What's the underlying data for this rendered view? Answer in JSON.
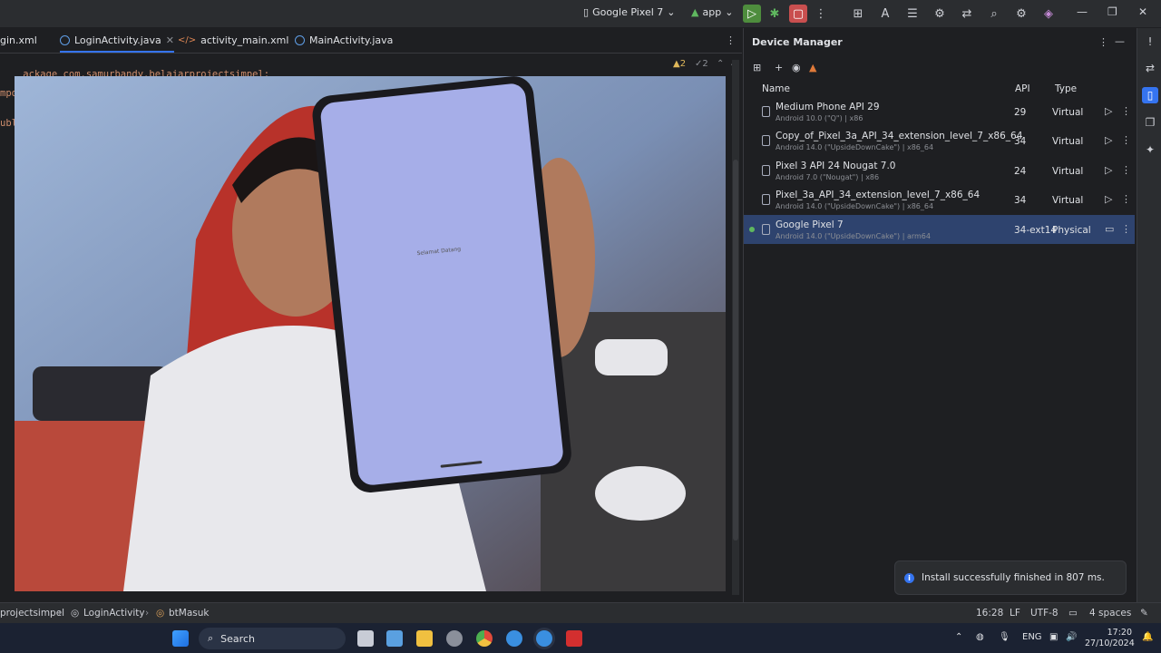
{
  "titlebar": {
    "device_selector": "Google Pixel 7",
    "run_config": "app"
  },
  "editor": {
    "tabs": [
      {
        "label": "gin.xml"
      },
      {
        "label": "LoginActivity.java"
      },
      {
        "label": "activity_main.xml"
      },
      {
        "label": "MainActivity.java"
      }
    ],
    "code_line_1": "ackage com.samurbandy.belajarprojectsimpel;",
    "code_frag_1": "mpo",
    "code_frag_2": "ubl",
    "warnings": "▲2",
    "checks": "✓2",
    "video_phone_text": "Selamat Datang"
  },
  "device_manager": {
    "title": "Device Manager",
    "columns": {
      "name": "Name",
      "api": "API",
      "type": "Type"
    },
    "devices": [
      {
        "name": "Medium Phone API 29",
        "sub": "Android 10.0 (\"Q\") | x86",
        "api": "29",
        "type": "Virtual"
      },
      {
        "name": "Copy_of_Pixel_3a_API_34_extension_level_7_x86_64",
        "sub": "Android 14.0 (\"UpsideDownCake\") | x86_64",
        "api": "34",
        "type": "Virtual"
      },
      {
        "name": "Pixel 3 API 24 Nougat 7.0",
        "sub": "Android 7.0 (\"Nougat\") | x86",
        "api": "24",
        "type": "Virtual"
      },
      {
        "name": "Pixel_3a_API_34_extension_level_7_x86_64",
        "sub": "Android 14.0 (\"UpsideDownCake\") | x86_64",
        "api": "34",
        "type": "Virtual"
      },
      {
        "name": "Google Pixel 7",
        "sub": "Android 14.0 (\"UpsideDownCake\") | arm64",
        "api": "34-ext14",
        "type": "Physical"
      }
    ]
  },
  "notification": {
    "text": "Install successfully finished in 807 ms."
  },
  "statusbar": {
    "crumb_project": "projectsimpel",
    "crumb_class": "LoginActivity",
    "crumb_field": "btMasuk",
    "position": "16:28",
    "line_sep": "LF",
    "encoding": "UTF-8",
    "indent": "4 spaces"
  },
  "taskbar": {
    "search_label": "Search",
    "lang": "ENG",
    "time": "17:20",
    "date": "27/10/2024"
  }
}
